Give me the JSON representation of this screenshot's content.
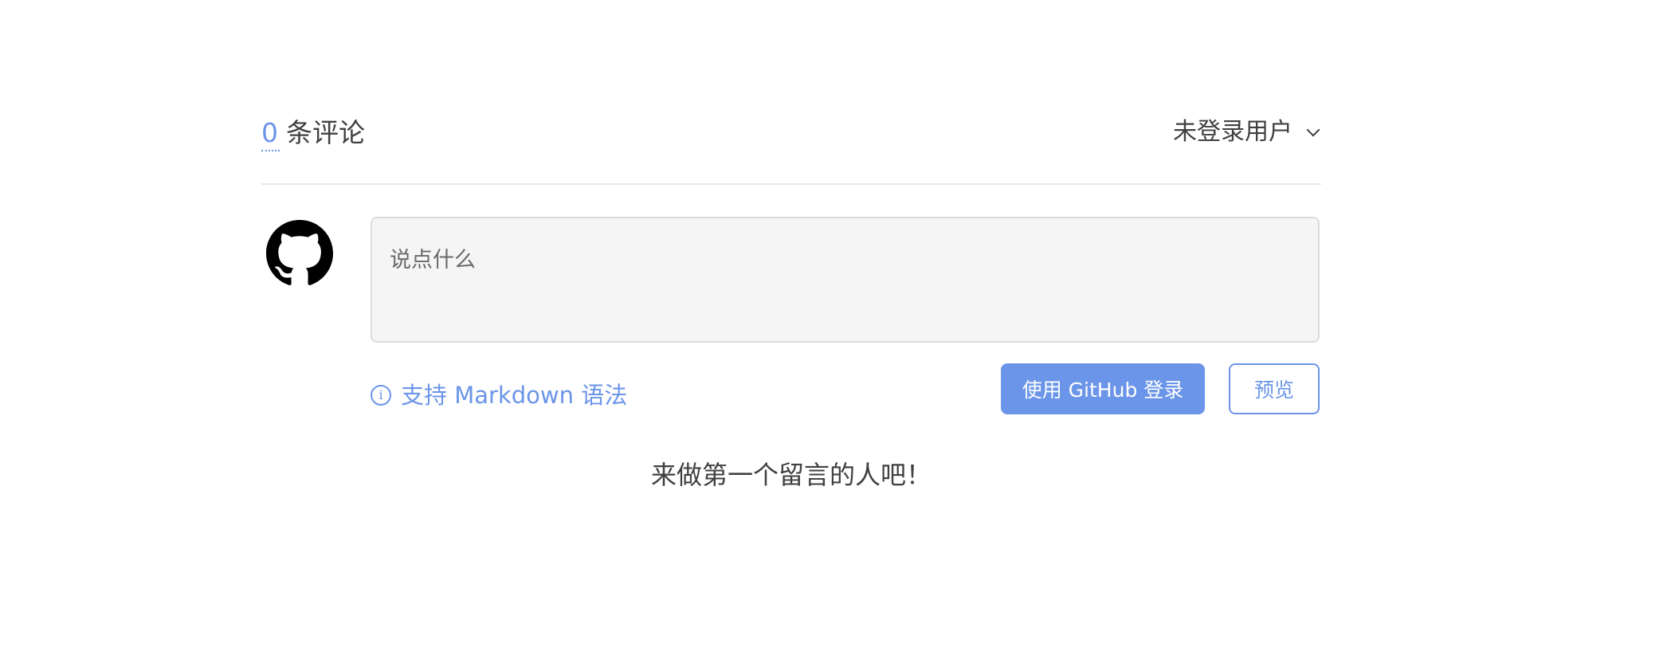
{
  "header": {
    "comment_count": "0",
    "comment_label": "条评论",
    "user_menu_label": "未登录用户"
  },
  "editor": {
    "placeholder": "说点什么",
    "avatar_icon": "github-icon"
  },
  "actions": {
    "markdown_tip": "支持 Markdown 语法",
    "login_button": "使用 GitHub 登录",
    "preview_button": "预览"
  },
  "empty_state": {
    "message": "来做第一个留言的人吧！"
  },
  "colors": {
    "accent": "#6b95e8",
    "text": "#404040",
    "textarea_bg": "#f5f5f5",
    "divider": "#e6e6e6"
  }
}
